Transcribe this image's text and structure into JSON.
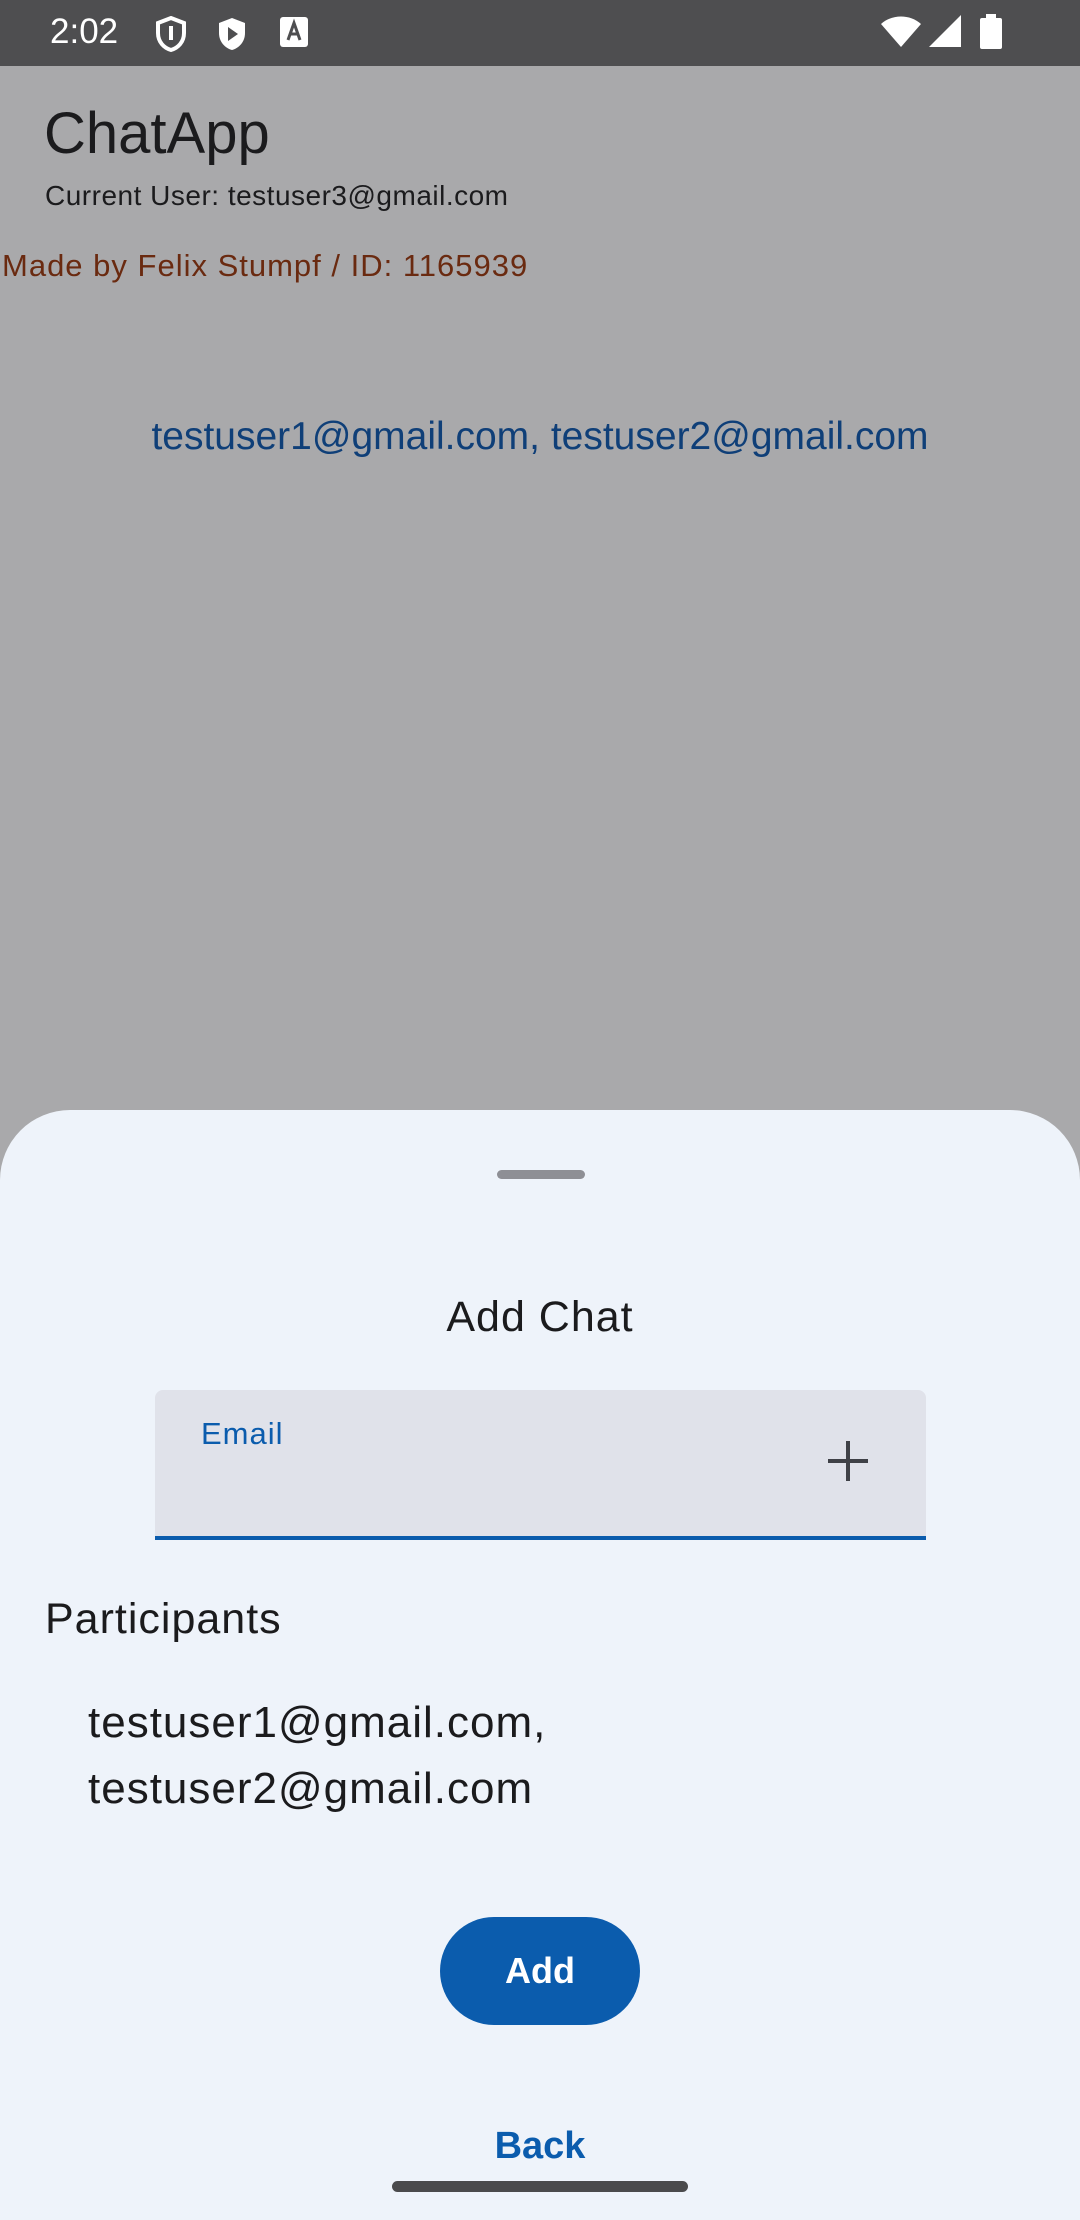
{
  "status_bar": {
    "time": "2:02",
    "left_icons": [
      "shield-outline-icon",
      "shield-play-icon",
      "keyboard-a-icon"
    ],
    "right_icons": [
      "wifi-icon",
      "cellular-signal-icon",
      "battery-icon"
    ]
  },
  "app": {
    "title": "ChatApp",
    "current_user": "Current User: testuser3@gmail.com",
    "made_by": "Made by Felix Stumpf / ID: 1165939",
    "chats": [
      "testuser1@gmail.com, testuser2@gmail.com"
    ]
  },
  "sheet": {
    "title": "Add Chat",
    "email_field": {
      "label": "Email",
      "value": "",
      "add_icon": "plus-icon"
    },
    "participants_label": "Participants",
    "participants": "testuser1@gmail.com, testuser2@gmail.com",
    "add_button": "Add",
    "back_link": "Back"
  },
  "colors": {
    "accent": "#0b5cad",
    "scrim": "#a9a9ab",
    "sheet_bg": "#eef3fa",
    "field_bg": "#e0e2ea",
    "made_by": "#6a2a10",
    "chat_link": "#0f3f78"
  }
}
